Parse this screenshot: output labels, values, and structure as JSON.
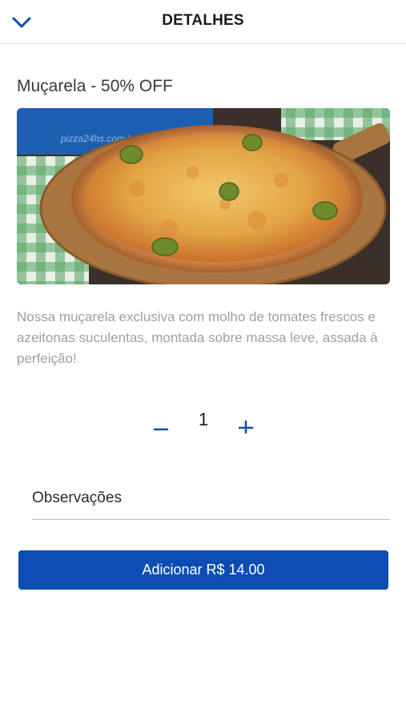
{
  "header": {
    "title": "DETALHES",
    "back_icon": "chevron-down-icon"
  },
  "product": {
    "name": "Muçarela - 50% OFF",
    "image_alt": "pizza-image",
    "box_text": "pizza24hs.com.br",
    "description": "Nossa muçarela exclusiva com molho de tomates frescos e azeitonas suculentas, montada sobre massa leve, assada à perfeição!"
  },
  "quantity": {
    "value": "1",
    "minus_icon": "minus-icon",
    "plus_icon": "plus-icon"
  },
  "observations": {
    "placeholder": "Observações",
    "value": ""
  },
  "add_button": {
    "label": "Adicionar R$ 14.00"
  },
  "colors": {
    "accent": "#0b4db3",
    "muted_text": "#a0a0a0"
  }
}
